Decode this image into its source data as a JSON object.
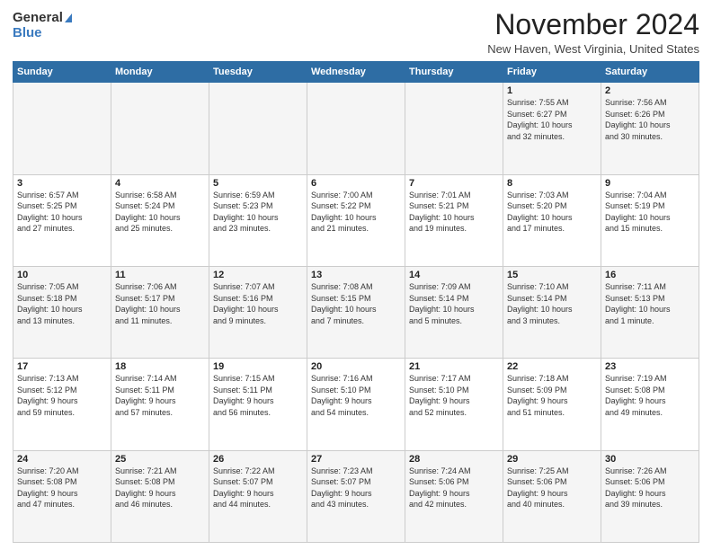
{
  "header": {
    "logo_general": "General",
    "logo_blue": "Blue",
    "month_title": "November 2024",
    "location": "New Haven, West Virginia, United States"
  },
  "days_of_week": [
    "Sunday",
    "Monday",
    "Tuesday",
    "Wednesday",
    "Thursday",
    "Friday",
    "Saturday"
  ],
  "weeks": [
    [
      {
        "day": "",
        "info": ""
      },
      {
        "day": "",
        "info": ""
      },
      {
        "day": "",
        "info": ""
      },
      {
        "day": "",
        "info": ""
      },
      {
        "day": "",
        "info": ""
      },
      {
        "day": "1",
        "info": "Sunrise: 7:55 AM\nSunset: 6:27 PM\nDaylight: 10 hours\nand 32 minutes."
      },
      {
        "day": "2",
        "info": "Sunrise: 7:56 AM\nSunset: 6:26 PM\nDaylight: 10 hours\nand 30 minutes."
      }
    ],
    [
      {
        "day": "3",
        "info": "Sunrise: 6:57 AM\nSunset: 5:25 PM\nDaylight: 10 hours\nand 27 minutes."
      },
      {
        "day": "4",
        "info": "Sunrise: 6:58 AM\nSunset: 5:24 PM\nDaylight: 10 hours\nand 25 minutes."
      },
      {
        "day": "5",
        "info": "Sunrise: 6:59 AM\nSunset: 5:23 PM\nDaylight: 10 hours\nand 23 minutes."
      },
      {
        "day": "6",
        "info": "Sunrise: 7:00 AM\nSunset: 5:22 PM\nDaylight: 10 hours\nand 21 minutes."
      },
      {
        "day": "7",
        "info": "Sunrise: 7:01 AM\nSunset: 5:21 PM\nDaylight: 10 hours\nand 19 minutes."
      },
      {
        "day": "8",
        "info": "Sunrise: 7:03 AM\nSunset: 5:20 PM\nDaylight: 10 hours\nand 17 minutes."
      },
      {
        "day": "9",
        "info": "Sunrise: 7:04 AM\nSunset: 5:19 PM\nDaylight: 10 hours\nand 15 minutes."
      }
    ],
    [
      {
        "day": "10",
        "info": "Sunrise: 7:05 AM\nSunset: 5:18 PM\nDaylight: 10 hours\nand 13 minutes."
      },
      {
        "day": "11",
        "info": "Sunrise: 7:06 AM\nSunset: 5:17 PM\nDaylight: 10 hours\nand 11 minutes."
      },
      {
        "day": "12",
        "info": "Sunrise: 7:07 AM\nSunset: 5:16 PM\nDaylight: 10 hours\nand 9 minutes."
      },
      {
        "day": "13",
        "info": "Sunrise: 7:08 AM\nSunset: 5:15 PM\nDaylight: 10 hours\nand 7 minutes."
      },
      {
        "day": "14",
        "info": "Sunrise: 7:09 AM\nSunset: 5:14 PM\nDaylight: 10 hours\nand 5 minutes."
      },
      {
        "day": "15",
        "info": "Sunrise: 7:10 AM\nSunset: 5:14 PM\nDaylight: 10 hours\nand 3 minutes."
      },
      {
        "day": "16",
        "info": "Sunrise: 7:11 AM\nSunset: 5:13 PM\nDaylight: 10 hours\nand 1 minute."
      }
    ],
    [
      {
        "day": "17",
        "info": "Sunrise: 7:13 AM\nSunset: 5:12 PM\nDaylight: 9 hours\nand 59 minutes."
      },
      {
        "day": "18",
        "info": "Sunrise: 7:14 AM\nSunset: 5:11 PM\nDaylight: 9 hours\nand 57 minutes."
      },
      {
        "day": "19",
        "info": "Sunrise: 7:15 AM\nSunset: 5:11 PM\nDaylight: 9 hours\nand 56 minutes."
      },
      {
        "day": "20",
        "info": "Sunrise: 7:16 AM\nSunset: 5:10 PM\nDaylight: 9 hours\nand 54 minutes."
      },
      {
        "day": "21",
        "info": "Sunrise: 7:17 AM\nSunset: 5:10 PM\nDaylight: 9 hours\nand 52 minutes."
      },
      {
        "day": "22",
        "info": "Sunrise: 7:18 AM\nSunset: 5:09 PM\nDaylight: 9 hours\nand 51 minutes."
      },
      {
        "day": "23",
        "info": "Sunrise: 7:19 AM\nSunset: 5:08 PM\nDaylight: 9 hours\nand 49 minutes."
      }
    ],
    [
      {
        "day": "24",
        "info": "Sunrise: 7:20 AM\nSunset: 5:08 PM\nDaylight: 9 hours\nand 47 minutes."
      },
      {
        "day": "25",
        "info": "Sunrise: 7:21 AM\nSunset: 5:08 PM\nDaylight: 9 hours\nand 46 minutes."
      },
      {
        "day": "26",
        "info": "Sunrise: 7:22 AM\nSunset: 5:07 PM\nDaylight: 9 hours\nand 44 minutes."
      },
      {
        "day": "27",
        "info": "Sunrise: 7:23 AM\nSunset: 5:07 PM\nDaylight: 9 hours\nand 43 minutes."
      },
      {
        "day": "28",
        "info": "Sunrise: 7:24 AM\nSunset: 5:06 PM\nDaylight: 9 hours\nand 42 minutes."
      },
      {
        "day": "29",
        "info": "Sunrise: 7:25 AM\nSunset: 5:06 PM\nDaylight: 9 hours\nand 40 minutes."
      },
      {
        "day": "30",
        "info": "Sunrise: 7:26 AM\nSunset: 5:06 PM\nDaylight: 9 hours\nand 39 minutes."
      }
    ]
  ]
}
